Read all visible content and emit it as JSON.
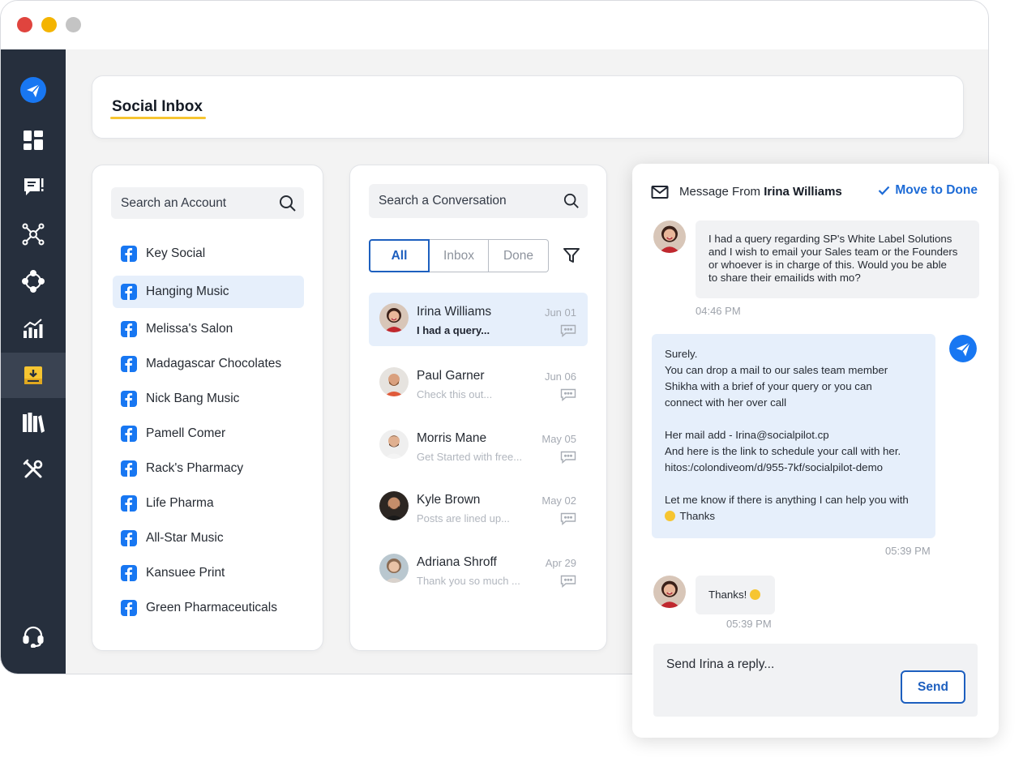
{
  "sidebar": {
    "items": [
      {
        "icon": "dashboard-icon"
      },
      {
        "icon": "posts-icon"
      },
      {
        "icon": "connections-icon"
      },
      {
        "icon": "accounts-icon"
      },
      {
        "icon": "analytics-icon"
      },
      {
        "icon": "inbox-icon",
        "active": true
      },
      {
        "icon": "library-icon"
      },
      {
        "icon": "tools-icon"
      }
    ],
    "support_icon": "headset-icon"
  },
  "header": {
    "title": "Social Inbox"
  },
  "accounts": {
    "search_placeholder": "Search an Account",
    "items": [
      {
        "name": "Key Social"
      },
      {
        "name": "Hanging Music",
        "selected": true
      },
      {
        "name": "Melissa's Salon"
      },
      {
        "name": "Madagascar Chocolates"
      },
      {
        "name": "Nick Bang Music"
      },
      {
        "name": "Pamell Comer"
      },
      {
        "name": "Rack's Pharmacy"
      },
      {
        "name": "Life Pharma"
      },
      {
        "name": "All-Star Music"
      },
      {
        "name": "Kansuee Print"
      },
      {
        "name": "Green Pharmaceuticals"
      }
    ]
  },
  "conversations": {
    "search_placeholder": "Search a Conversation",
    "tabs": {
      "all": "All",
      "inbox": "Inbox",
      "done": "Done"
    },
    "items": [
      {
        "name": "Irina Williams",
        "preview": "I had a query...",
        "date": "Jun 01",
        "selected": true
      },
      {
        "name": "Paul Garner",
        "preview": "Check this out...",
        "date": "Jun 06"
      },
      {
        "name": "Morris Mane",
        "preview": "Get Started with free...",
        "date": "May 05"
      },
      {
        "name": "Kyle Brown",
        "preview": "Posts are lined up...",
        "date": "May 02"
      },
      {
        "name": "Adriana Shroff",
        "preview": "Thank you so much ...",
        "date": "Apr 29"
      }
    ]
  },
  "message": {
    "from_prefix": "Message From",
    "from_name": "Irina Williams",
    "move_to_done": "Move to Done",
    "thread": [
      {
        "direction": "in",
        "lines": [
          "I had a query regarding SP's White Label Solutions",
          "and I wish to email your Sales team or the Founders",
          "or whoever is in charge of this. Would you be able",
          "to share their emaiIids with mo?"
        ],
        "time": "04:46 PM"
      },
      {
        "direction": "out",
        "lines": [
          "Surely.",
          "You can drop a mail to our sales team member",
          "Shikha with a brief of your query or you can",
          "connect with her over call",
          "",
          "Her mail add - Irina@socialpilot.cp",
          "And here is the link to schedule your call with her.",
          "hitos:/colondiveom/d/955-7kf/socialpilot-demo",
          "",
          "Let me know if there is anything I can help you with",
          "Thanks"
        ],
        "time": "05:39 PM"
      },
      {
        "direction": "in",
        "lines": [
          "Thanks!"
        ],
        "time": "05:39 PM"
      }
    ],
    "reply_placeholder": "Send Irina a reply...",
    "send_label": "Send"
  },
  "colors": {
    "brand_blue": "#1877f2",
    "accent_blue": "#1d5fbf",
    "sidebar_bg": "#262f3d",
    "highlight": "#f6c531",
    "selected_bg": "#e6effb"
  }
}
